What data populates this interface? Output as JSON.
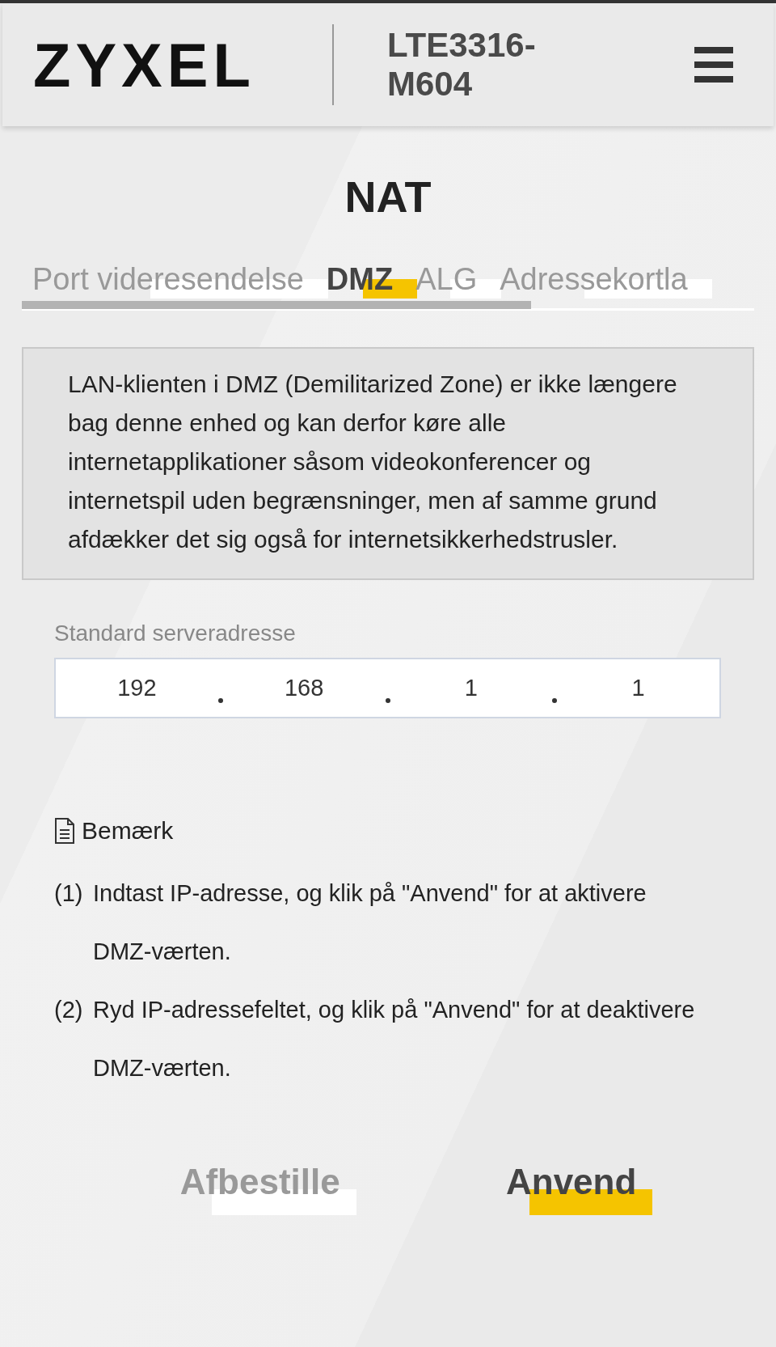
{
  "header": {
    "logo": "ZYXEL",
    "model": "LTE3316-M604"
  },
  "page_title": "NAT",
  "tabs": [
    {
      "label": "Port videresendelse",
      "selected": false
    },
    {
      "label": "DMZ",
      "selected": true
    },
    {
      "label": "ALG",
      "selected": false
    },
    {
      "label": "Adressekortla",
      "selected": false
    }
  ],
  "info": "LAN-klienten i DMZ (Demilitarized Zone) er ikke længere bag denne enhed og kan derfor køre alle internetapplikationer såsom videokonferencer og internetspil uden begrænsninger, men af samme grund afdækker det sig også for internetsikkerhedstrusler.",
  "server_field": {
    "label": "Standard serveradresse",
    "octets": [
      "192",
      "168",
      "1",
      "1"
    ]
  },
  "note": {
    "title": "Bemærk",
    "items": [
      {
        "marker": "(1)",
        "text": "Indtast IP-adresse, og klik på \"Anvend\" for at aktivere DMZ-værten."
      },
      {
        "marker": "(2)",
        "text": "Ryd IP-adressefeltet, og klik på \"Anvend\" for at deaktivere DMZ-værten."
      }
    ]
  },
  "buttons": [
    {
      "label": "Afbestille",
      "kind": "secondary"
    },
    {
      "label": "Anvend",
      "kind": "primary"
    }
  ]
}
